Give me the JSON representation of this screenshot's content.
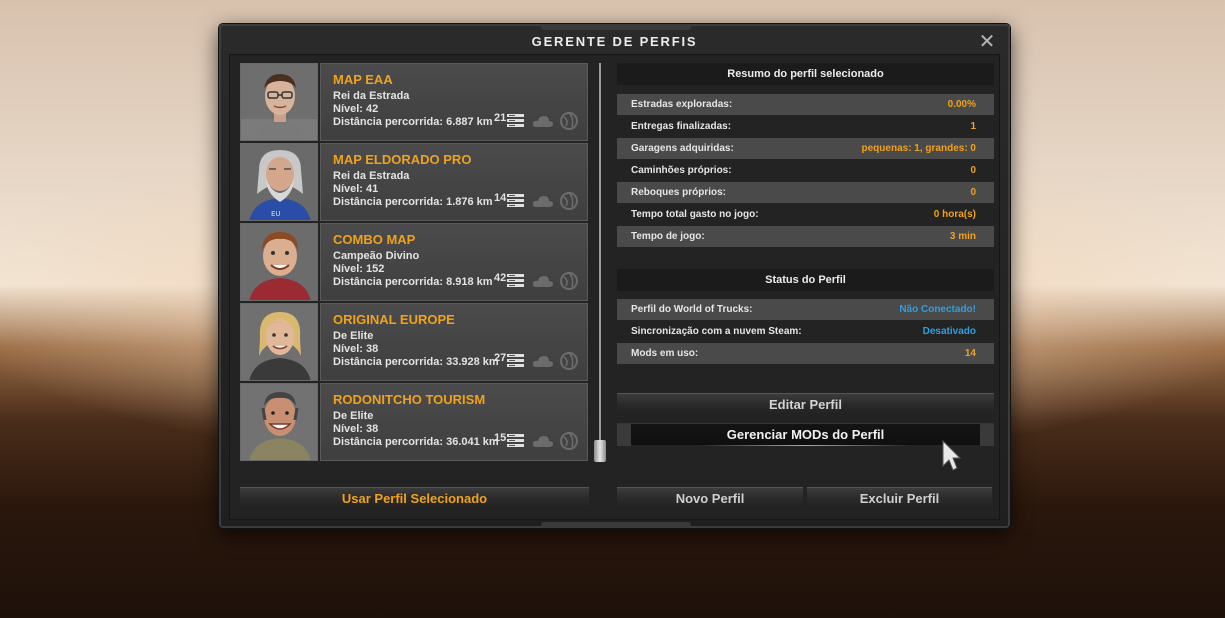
{
  "window": {
    "title": "GERENTE DE PERFIS"
  },
  "profiles": [
    {
      "name": "MAP EAA",
      "rank": "Rei da Estrada",
      "level": "Nível: 42",
      "distance": "Distância percorrida: 6.887 km",
      "mods": "21"
    },
    {
      "name": "MAP ELDORADO PRO",
      "rank": "Rei da Estrada",
      "level": "Nível: 41",
      "distance": "Distância percorrida: 1.876 km",
      "mods": "14"
    },
    {
      "name": "COMBO MAP",
      "rank": "Campeão Divino",
      "level": "Nível: 152",
      "distance": "Distância percorrida: 8.918 km",
      "mods": "42"
    },
    {
      "name": "ORIGINAL EUROPE",
      "rank": "De Elite",
      "level": "Nível: 38",
      "distance": "Distância percorrida: 33.928 km",
      "mods": "27"
    },
    {
      "name": "RODONITCHO TOURISM",
      "rank": "De Elite",
      "level": "Nível: 38",
      "distance": "Distância percorrida: 36.041 km",
      "mods": "15"
    }
  ],
  "summary": {
    "title": "Resumo do perfil selecionado",
    "rows": [
      {
        "label": "Estradas exploradas:",
        "value": "0.00%"
      },
      {
        "label": "Entregas finalizadas:",
        "value": "1"
      },
      {
        "label": "Garagens adquiridas:",
        "value": "pequenas: 1, grandes: 0"
      },
      {
        "label": "Caminhões próprios:",
        "value": "0"
      },
      {
        "label": "Reboques próprios:",
        "value": "0"
      },
      {
        "label": "Tempo total gasto no jogo:",
        "value": "0 hora(s)"
      },
      {
        "label": "Tempo de jogo:",
        "value": "3 min"
      }
    ]
  },
  "status": {
    "title": "Status do Perfil",
    "rows": [
      {
        "label": "Perfil do World of Trucks:",
        "value": "Não Conectado!"
      },
      {
        "label": "Sincronização com a nuvem Steam:",
        "value": "Desativado"
      },
      {
        "label": "Mods em uso:",
        "value": "14"
      }
    ]
  },
  "buttons": {
    "edit": "Editar Perfil",
    "manage_mods": "Gerenciar MODs do Perfil",
    "use": "Usar Perfil Selecionado",
    "new": "Novo Perfil",
    "delete": "Excluir Perfil"
  },
  "colors": {
    "accent": "#f0a21c",
    "link": "#2e9fe0"
  }
}
